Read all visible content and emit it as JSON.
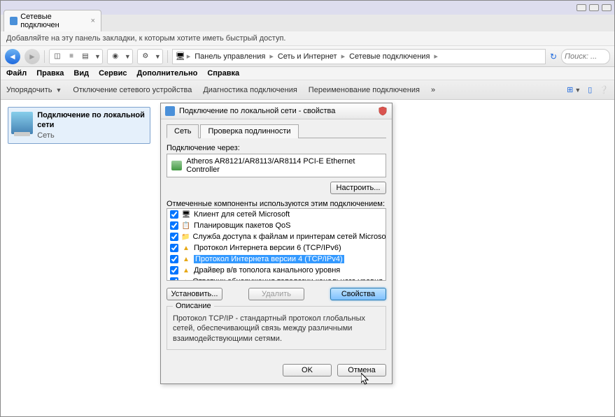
{
  "browser": {
    "tab_title": "Сетевые подключен",
    "bookmarks_hint": "Добавляйте на эту панель закладки, к которым хотите иметь быстрый доступ."
  },
  "breadcrumb": {
    "items": [
      "Панель управления",
      "Сеть и Интернет",
      "Сетевые подключения"
    ]
  },
  "search_placeholder": "Поиск: ...",
  "menus": [
    "Файл",
    "Правка",
    "Вид",
    "Сервис",
    "Дополнительно",
    "Справка"
  ],
  "commands": {
    "organize": "Упорядочить",
    "disable": "Отключение сетевого устройства",
    "diagnose": "Диагностика подключения",
    "rename": "Переименование подключения",
    "more": "»"
  },
  "connection": {
    "title": "Подключение по локальной сети",
    "status": "Сеть"
  },
  "dialog": {
    "title": "Подключение по локальной сети - свойства",
    "tabs": {
      "network": "Сеть",
      "auth": "Проверка подлинности"
    },
    "connect_via_label": "Подключение через:",
    "adapter": "Atheros AR8121/AR8113/AR8114 PCI-E Ethernet Controller",
    "configure_btn": "Настроить...",
    "components_label": "Отмеченные компоненты используются этим подключением:",
    "components": [
      {
        "label": "Клиент для сетей Microsoft",
        "icon": "client"
      },
      {
        "label": "Планировщик пакетов QoS",
        "icon": "qos"
      },
      {
        "label": "Служба доступа к файлам и принтерам сетей Microsoft",
        "icon": "share"
      },
      {
        "label": "Протокол Интернета версии 6 (TCP/IPv6)",
        "icon": "proto"
      },
      {
        "label": "Протокол Интернета версии 4 (TCP/IPv4)",
        "icon": "proto",
        "selected": true
      },
      {
        "label": "Драйвер в/в тополога канального уровня",
        "icon": "proto"
      },
      {
        "label": "Ответчик обнаружения топологии канального уровня",
        "icon": "proto"
      }
    ],
    "install_btn": "Установить...",
    "remove_btn": "Удалить",
    "props_btn": "Свойства",
    "desc_title": "Описание",
    "desc_text": "Протокол TCP/IP - стандартный протокол глобальных сетей, обеспечивающий связь между различными взаимодействующими сетями.",
    "ok": "OK",
    "cancel": "Отмена"
  }
}
